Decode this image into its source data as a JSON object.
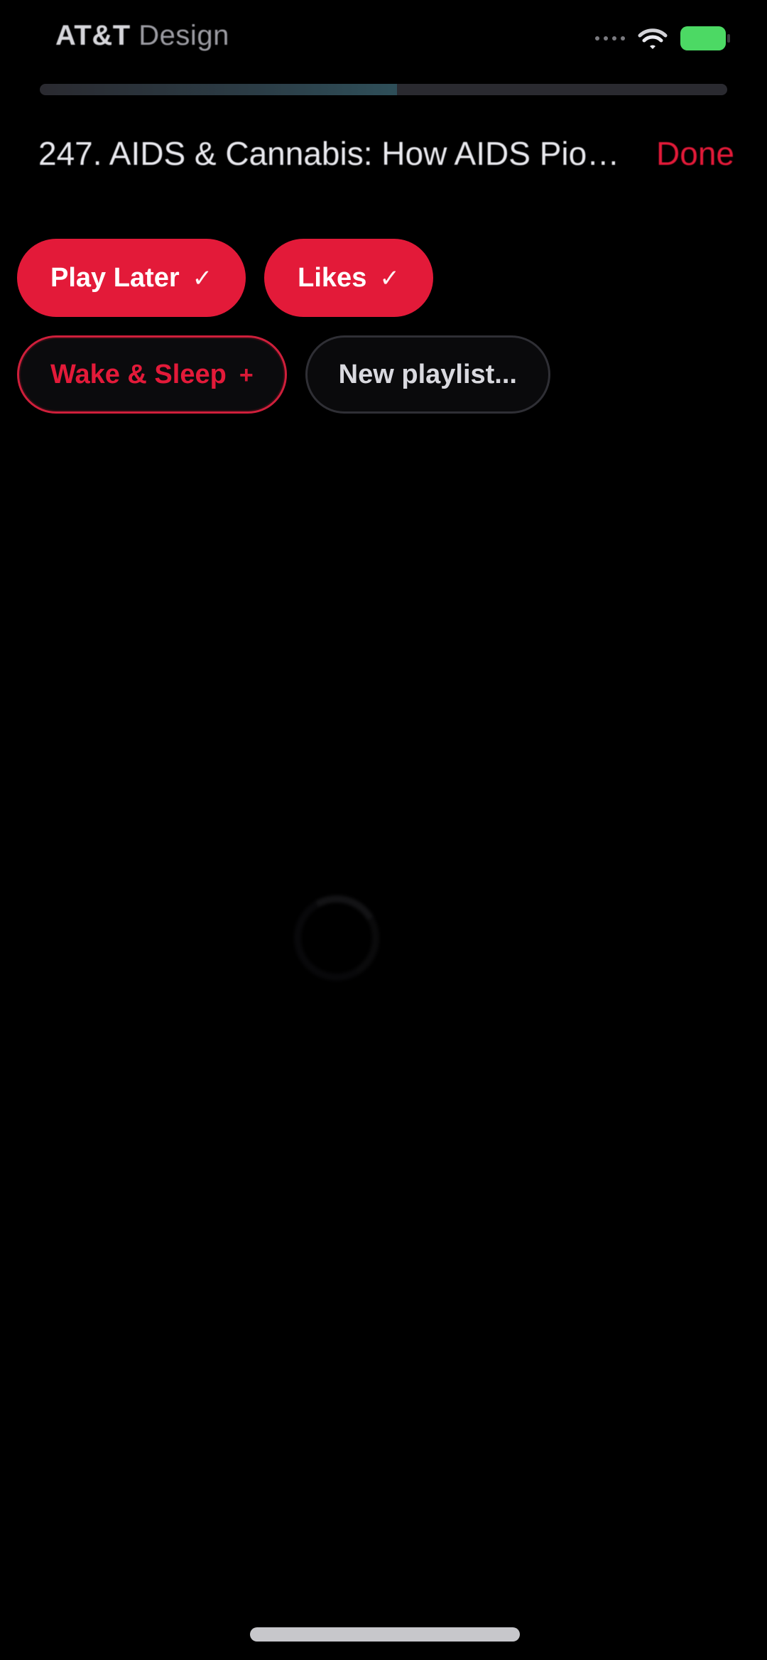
{
  "status_bar": {
    "carrier_text": "AT&T",
    "carrier_suffix": "Design",
    "battery_color": "#4cd964",
    "icons": [
      "signal-dots-icon",
      "wifi-icon",
      "battery-icon"
    ]
  },
  "player": {
    "progress_fraction": 0.52
  },
  "header": {
    "title": "247. AIDS & Cannabis: How AIDS Pione...",
    "done_label": "Done",
    "accent_color": "#e31a39"
  },
  "chips": {
    "row1": [
      {
        "label": "Play Later",
        "style": "filled",
        "icon": "✓"
      },
      {
        "label": "Likes",
        "style": "filled",
        "icon": "✓"
      }
    ],
    "row2": [
      {
        "label": "Wake & Sleep",
        "style": "outline-red",
        "icon": "+"
      },
      {
        "label": "New playlist...",
        "style": "outline-gray",
        "icon": ""
      }
    ]
  }
}
